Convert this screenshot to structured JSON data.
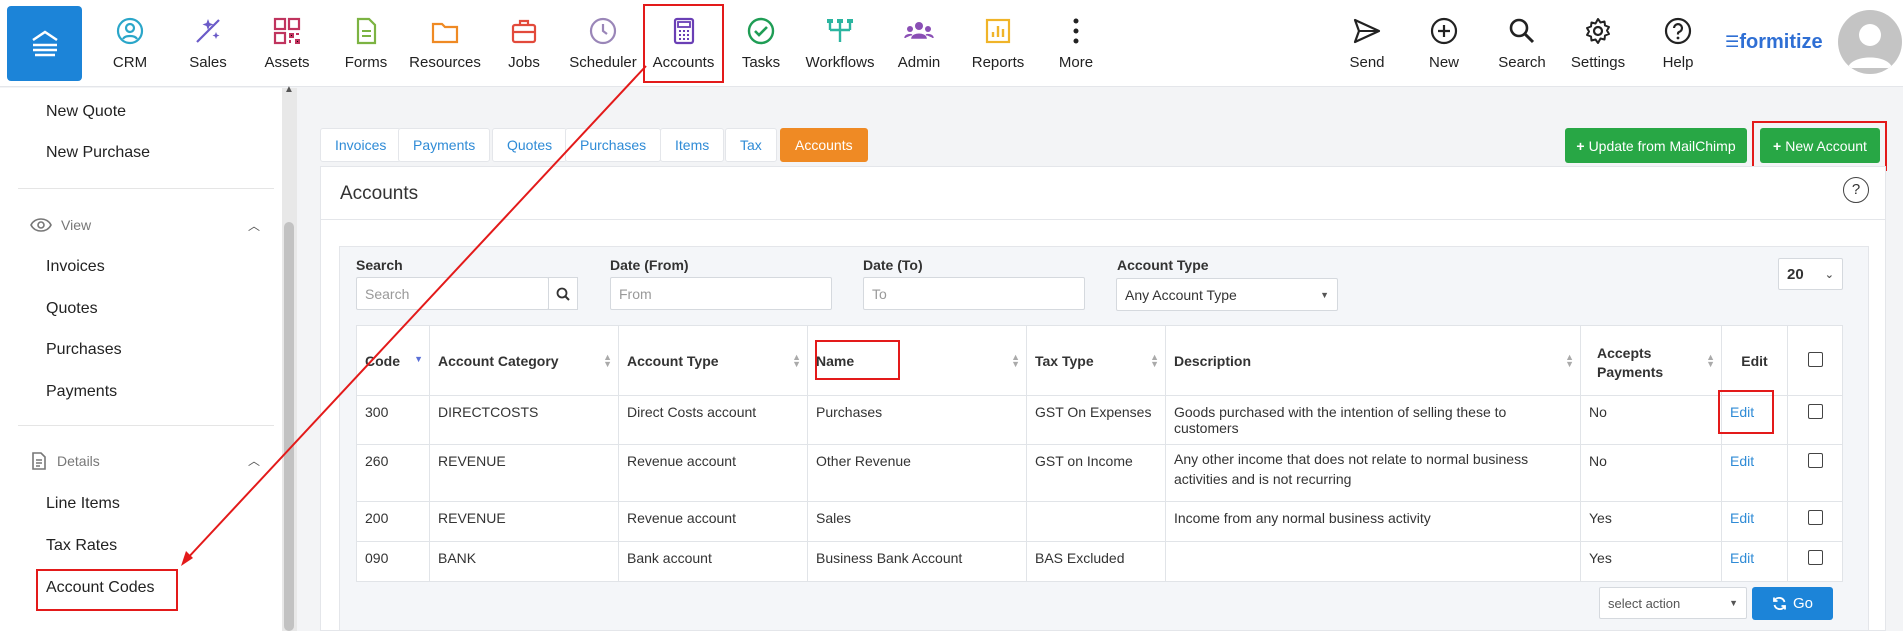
{
  "nav": {
    "items": [
      {
        "label": "CRM",
        "icon": "crm-icon"
      },
      {
        "label": "Sales",
        "icon": "sales-icon"
      },
      {
        "label": "Assets",
        "icon": "assets-icon"
      },
      {
        "label": "Forms",
        "icon": "forms-icon"
      },
      {
        "label": "Resources",
        "icon": "resources-icon"
      },
      {
        "label": "Jobs",
        "icon": "jobs-icon"
      },
      {
        "label": "Scheduler",
        "icon": "scheduler-icon"
      },
      {
        "label": "Accounts",
        "icon": "accounts-icon"
      },
      {
        "label": "Tasks",
        "icon": "tasks-icon"
      },
      {
        "label": "Workflows",
        "icon": "workflows-icon"
      },
      {
        "label": "Admin",
        "icon": "admin-icon"
      },
      {
        "label": "Reports",
        "icon": "reports-icon"
      },
      {
        "label": "More",
        "icon": "more-icon"
      }
    ],
    "right": [
      {
        "label": "Send",
        "icon": "send-icon"
      },
      {
        "label": "New",
        "icon": "plus-circle-icon"
      },
      {
        "label": "Search",
        "icon": "search-icon"
      },
      {
        "label": "Settings",
        "icon": "gear-icon"
      },
      {
        "label": "Help",
        "icon": "help-icon"
      }
    ],
    "brand": "formitize"
  },
  "sidebar": {
    "top_links": [
      "New Quote",
      "New Purchase"
    ],
    "view_heading": "View",
    "view_links": [
      "Invoices",
      "Quotes",
      "Purchases",
      "Payments"
    ],
    "details_heading": "Details",
    "details_links": [
      "Line Items",
      "Tax Rates",
      "Account Codes"
    ]
  },
  "tabs": [
    "Invoices",
    "Payments",
    "Quotes",
    "Purchases",
    "Items",
    "Tax",
    "Accounts"
  ],
  "buttons": {
    "update_mailchimp": "Update from MailChimp",
    "new_account": "New Account",
    "go": "Go"
  },
  "panel": {
    "title": "Accounts",
    "help": "?"
  },
  "filters": {
    "search_label": "Search",
    "search_placeholder": "Search",
    "date_from_label": "Date (From)",
    "date_from_placeholder": "From",
    "date_to_label": "Date (To)",
    "date_to_placeholder": "To",
    "account_type_label": "Account Type",
    "account_type_value": "Any Account Type",
    "page_size": "20"
  },
  "table": {
    "headers": [
      "Code",
      "Account Category",
      "Account Type",
      "Name",
      "Tax Type",
      "Description",
      "Accepts Payments",
      "Edit"
    ],
    "rows": [
      {
        "code": "300",
        "category": "DIRECTCOSTS",
        "type": "Direct Costs account",
        "name": "Purchases",
        "tax": "GST On Expenses",
        "desc": "Goods purchased with the intention of selling these to customers",
        "accepts": "No",
        "edit": "Edit"
      },
      {
        "code": "260",
        "category": "REVENUE",
        "type": "Revenue account",
        "name": "Other Revenue",
        "tax": "GST on Income",
        "desc": "Any other income that does not relate to normal business activities and is not recurring",
        "accepts": "No",
        "edit": "Edit"
      },
      {
        "code": "200",
        "category": "REVENUE",
        "type": "Revenue account",
        "name": "Sales",
        "tax": "",
        "desc": "Income from any normal business activity",
        "accepts": "Yes",
        "edit": "Edit"
      },
      {
        "code": "090",
        "category": "BANK",
        "type": "Bank account",
        "name": "Business Bank Account",
        "tax": "BAS Excluded",
        "desc": "",
        "accepts": "Yes",
        "edit": "Edit"
      }
    ]
  },
  "bulk": {
    "action_placeholder": "select action"
  },
  "colors": {
    "primary": "#1c84d8",
    "green": "#28a745",
    "orange": "#ef8a24",
    "annotation": "#e31a1a"
  }
}
